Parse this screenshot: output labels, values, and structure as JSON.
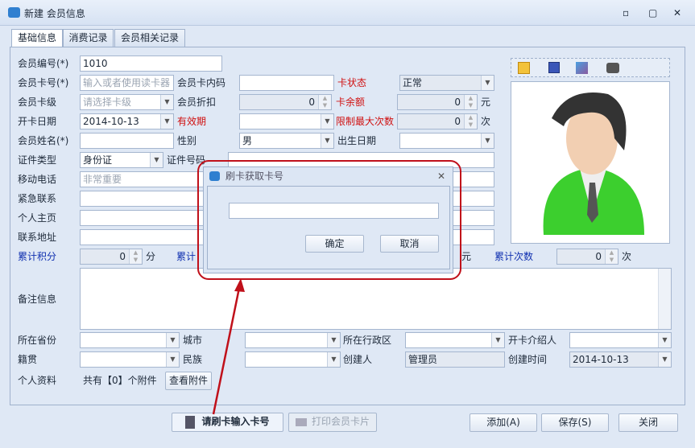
{
  "window": {
    "title": "新建 会员信息",
    "minimize": "▫",
    "maximize": "▢",
    "close": "✕"
  },
  "tabs": [
    {
      "label": "基础信息"
    },
    {
      "label": "消费记录"
    },
    {
      "label": "会员相关记录"
    }
  ],
  "form": {
    "member_no": {
      "label": "会员编号(*)",
      "value": "1010"
    },
    "card_no": {
      "label": "会员卡号(*)",
      "placeholder": "输入或者使用读卡器"
    },
    "card_inner_code": {
      "label": "会员卡内码",
      "value": ""
    },
    "card_status": {
      "label": "卡状态",
      "value": "正常"
    },
    "card_level": {
      "label": "会员卡级",
      "placeholder": "请选择卡级"
    },
    "discount": {
      "label": "会员折扣",
      "value": "0"
    },
    "balance": {
      "label": "卡余额",
      "value": "0",
      "unit": "元"
    },
    "open_date": {
      "label": "开卡日期",
      "value": "2014-10-13"
    },
    "valid_period": {
      "label": "有效期",
      "value": ""
    },
    "max_times": {
      "label": "限制最大次数",
      "value": "0",
      "unit": "次"
    },
    "name": {
      "label": "会员姓名(*)",
      "value": ""
    },
    "gender": {
      "label": "性别",
      "value": "男"
    },
    "birthday": {
      "label": "出生日期",
      "value": ""
    },
    "id_type": {
      "label": "证件类型",
      "value": "身份证"
    },
    "id_no": {
      "label": "证件号码",
      "value": ""
    },
    "mobile": {
      "label": "移动电话",
      "placeholder": "非常重要"
    },
    "emergency": {
      "label": "紧急联系"
    },
    "homepage": {
      "label": "个人主页"
    },
    "address": {
      "label": "联系地址"
    },
    "points": {
      "label": "累计积分",
      "value": "0",
      "unit": "分"
    },
    "total_consume": {
      "label": "累计",
      "unit": "元"
    },
    "total_times": {
      "label": "累计次数",
      "value": "0",
      "unit": "次"
    },
    "remark": {
      "label": "备注信息"
    },
    "province": {
      "label": "所在省份"
    },
    "city": {
      "label": "城市"
    },
    "district": {
      "label": "所在行政区"
    },
    "referrer": {
      "label": "开卡介绍人"
    },
    "native": {
      "label": "籍贯"
    },
    "ethnic": {
      "label": "民族"
    },
    "creator": {
      "label": "创建人",
      "value": "管理员"
    },
    "create_time": {
      "label": "创建时间",
      "value": "2014-10-13"
    },
    "attachments": {
      "label": "个人资料",
      "text": "共有【0】个附件",
      "button": "查看附件"
    }
  },
  "photo_toolbar": [
    "edit-icon",
    "save-icon",
    "import-image-icon",
    "camera-icon"
  ],
  "buttons": {
    "swipe": "请刷卡输入卡号",
    "print": "打印会员卡片",
    "add": "添加(A)",
    "save": "保存(S)",
    "close": "关闭"
  },
  "dialog": {
    "title": "刷卡获取卡号",
    "value": "",
    "ok": "确定",
    "cancel": "取消"
  },
  "colors": {
    "required_red": "#d01010",
    "highlight_blue": "#1030b0",
    "annotation": "#c0101a",
    "avatar_green": "#33cc33"
  }
}
